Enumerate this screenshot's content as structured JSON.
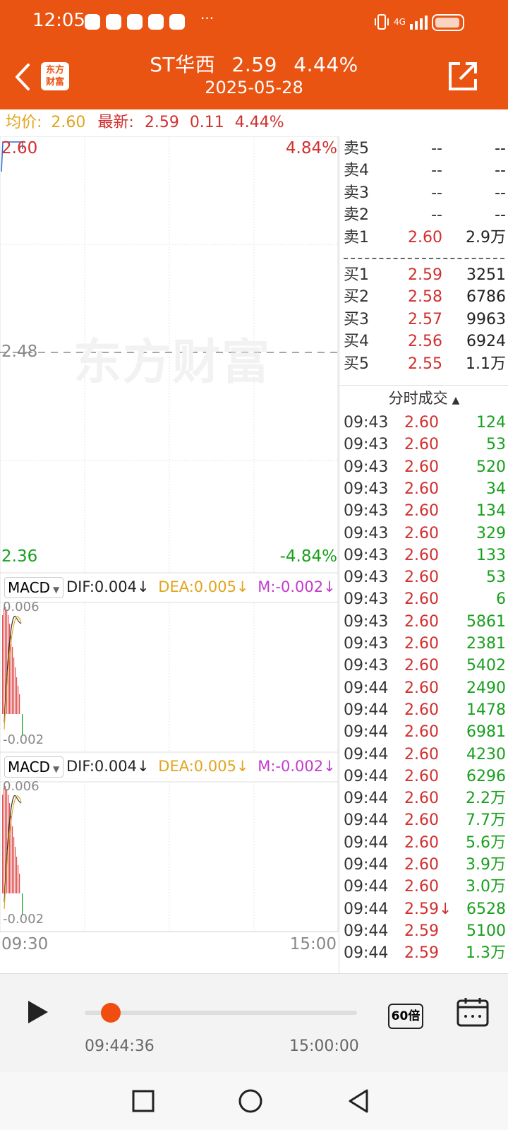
{
  "status_bar": {
    "time": "12:05",
    "more": "···",
    "network": "4G"
  },
  "header": {
    "logo_text_1": "东方",
    "logo_text_2": "财富",
    "stock_name": "ST华西",
    "price": "2.59",
    "change_pct": "4.44%",
    "date": "2025-05-28"
  },
  "summary": {
    "avg_label": "均价:",
    "avg_value": "2.60",
    "new_label": "最新:",
    "new_value": "2.59",
    "change": "0.11",
    "change_pct": "4.44%"
  },
  "chart": {
    "price_top": "2.60",
    "pct_top": "4.84%",
    "price_mid": "2.48",
    "price_bottom": "2.36",
    "pct_bottom": "-4.84%",
    "watermark": "东方财富",
    "time_start": "09:30",
    "time_end": "15:00",
    "macd_panels": [
      {
        "label": "MACD",
        "dif": "DIF:0.004↓",
        "dea": "DEA:0.005↓",
        "m": "M:-0.002↓",
        "top": "0.006",
        "bottom": "-0.002"
      },
      {
        "label": "MACD",
        "dif": "DIF:0.004↓",
        "dea": "DEA:0.005↓",
        "m": "M:-0.002↓",
        "top": "0.006",
        "bottom": "-0.002"
      }
    ],
    "colors": {
      "up": "#d0302f",
      "down": "#18a01d",
      "dea": "#e1a41e",
      "m": "#c23bcc"
    }
  },
  "order_book": {
    "asks": [
      {
        "label": "卖5",
        "price": "--",
        "volume": "--"
      },
      {
        "label": "卖4",
        "price": "--",
        "volume": "--"
      },
      {
        "label": "卖3",
        "price": "--",
        "volume": "--"
      },
      {
        "label": "卖2",
        "price": "--",
        "volume": "--"
      },
      {
        "label": "卖1",
        "price": "2.60",
        "volume": "2.9万"
      }
    ],
    "bids": [
      {
        "label": "买1",
        "price": "2.59",
        "volume": "3251"
      },
      {
        "label": "买2",
        "price": "2.58",
        "volume": "6786"
      },
      {
        "label": "买3",
        "price": "2.57",
        "volume": "9963"
      },
      {
        "label": "买4",
        "price": "2.56",
        "volume": "6924"
      },
      {
        "label": "买5",
        "price": "2.55",
        "volume": "1.1万"
      }
    ]
  },
  "ticks": {
    "header": "分时成交",
    "rows": [
      {
        "time": "09:43",
        "price": "2.60",
        "volume": "124"
      },
      {
        "time": "09:43",
        "price": "2.60",
        "volume": "53"
      },
      {
        "time": "09:43",
        "price": "2.60",
        "volume": "520"
      },
      {
        "time": "09:43",
        "price": "2.60",
        "volume": "34"
      },
      {
        "time": "09:43",
        "price": "2.60",
        "volume": "134"
      },
      {
        "time": "09:43",
        "price": "2.60",
        "volume": "329"
      },
      {
        "time": "09:43",
        "price": "2.60",
        "volume": "133"
      },
      {
        "time": "09:43",
        "price": "2.60",
        "volume": "53"
      },
      {
        "time": "09:43",
        "price": "2.60",
        "volume": "6"
      },
      {
        "time": "09:43",
        "price": "2.60",
        "volume": "5861"
      },
      {
        "time": "09:43",
        "price": "2.60",
        "volume": "2381"
      },
      {
        "time": "09:43",
        "price": "2.60",
        "volume": "5402"
      },
      {
        "time": "09:44",
        "price": "2.60",
        "volume": "2490"
      },
      {
        "time": "09:44",
        "price": "2.60",
        "volume": "1478"
      },
      {
        "time": "09:44",
        "price": "2.60",
        "volume": "6981"
      },
      {
        "time": "09:44",
        "price": "2.60",
        "volume": "4230"
      },
      {
        "time": "09:44",
        "price": "2.60",
        "volume": "6296"
      },
      {
        "time": "09:44",
        "price": "2.60",
        "volume": "2.2万"
      },
      {
        "time": "09:44",
        "price": "2.60",
        "volume": "7.7万"
      },
      {
        "time": "09:44",
        "price": "2.60",
        "volume": "5.6万"
      },
      {
        "time": "09:44",
        "price": "2.60",
        "volume": "3.9万"
      },
      {
        "time": "09:44",
        "price": "2.60",
        "volume": "3.0万"
      },
      {
        "time": "09:44",
        "price": "2.59↓",
        "volume": "6528"
      },
      {
        "time": "09:44",
        "price": "2.59",
        "volume": "5100"
      },
      {
        "time": "09:44",
        "price": "2.59",
        "volume": "1.3万"
      }
    ]
  },
  "playback": {
    "current_time": "09:44:36",
    "end_time": "15:00:00",
    "speed": "60倍",
    "progress_fraction": 0.06
  }
}
